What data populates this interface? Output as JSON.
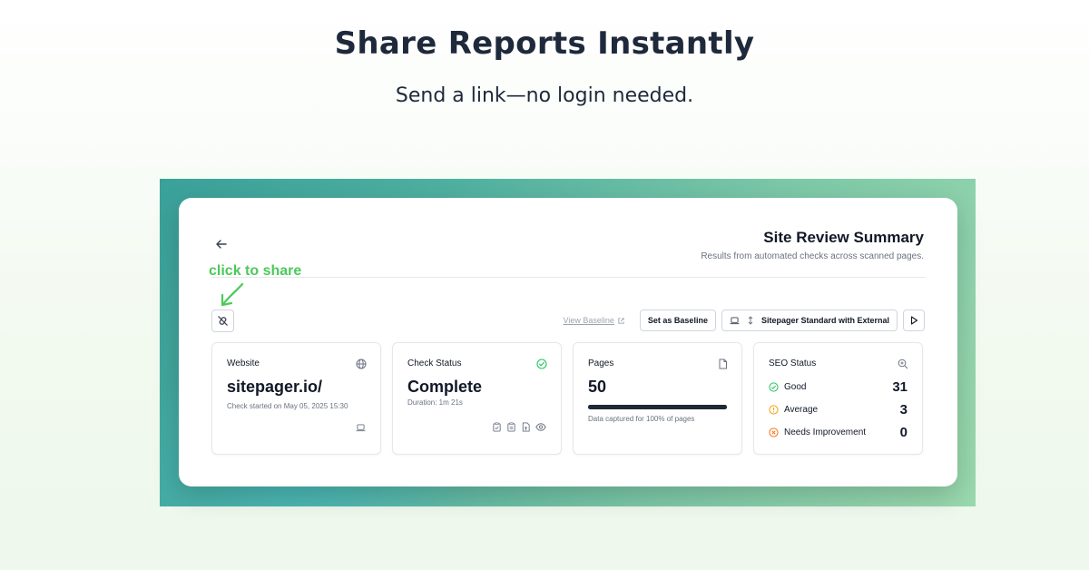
{
  "hero": {
    "title": "Share Reports Instantly",
    "subtitle": "Send a link—no login needed."
  },
  "annotation": {
    "text": "click to share",
    "color": "#4cc95a"
  },
  "header": {
    "title": "Site Review Summary",
    "subtitle": "Results from automated checks across scanned pages."
  },
  "toolbar": {
    "view_baseline": "View Baseline",
    "set_baseline": "Set as Baseline",
    "profile": "Sitepager Standard with External"
  },
  "cards": {
    "website": {
      "label": "Website",
      "value": "sitepager.io/",
      "note": "Check started on May 05, 2025 15:30"
    },
    "check": {
      "label": "Check Status",
      "value": "Complete",
      "note": "Duration: 1m 21s"
    },
    "pages": {
      "label": "Pages",
      "value": "50",
      "note": "Data captured for 100% of pages",
      "progress": 1.0
    },
    "seo": {
      "label": "SEO Status",
      "items": [
        {
          "name": "Good",
          "count": "31",
          "color": "#22c55e"
        },
        {
          "name": "Average",
          "count": "3",
          "color": "#f59e0b"
        },
        {
          "name": "Needs Improvement",
          "count": "0",
          "color": "#f97316"
        }
      ]
    }
  },
  "colors": {
    "accent_green": "#4cc95a",
    "text_dark": "#111827"
  }
}
